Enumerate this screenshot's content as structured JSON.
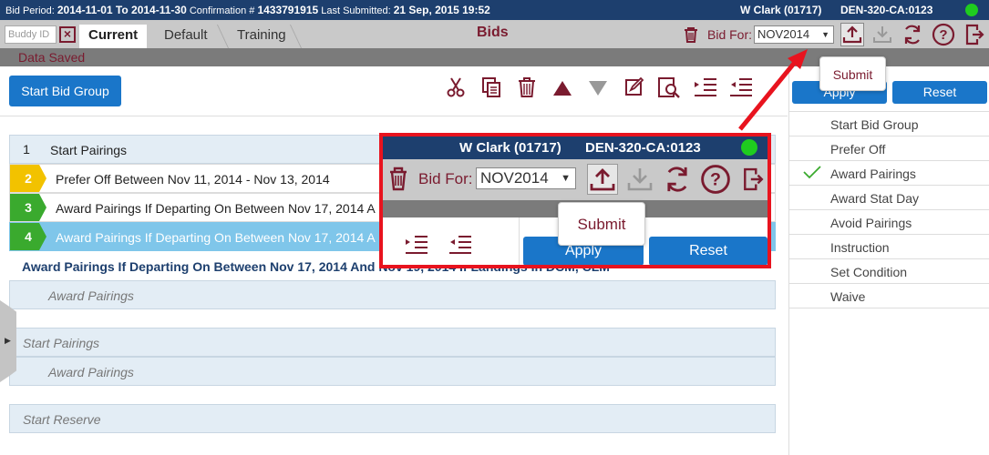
{
  "topbar": {
    "bid_period_label": "Bid Period:",
    "bid_period_value": "2014-11-01 To 2014-11-30",
    "confirmation_label": "Confirmation #",
    "confirmation_value": "1433791915",
    "last_submitted_label": "Last Submitted:",
    "last_submitted_value": "21 Sep, 2015 19:52",
    "user": "W Clark (01717)",
    "code": "DEN-320-CA:0123",
    "status_color": "#1fcc1f"
  },
  "tabbar": {
    "buddy_placeholder": "Buddy ID",
    "tabs": [
      "Current",
      "Default",
      "Training"
    ],
    "title": "Bids",
    "bid_for_label": "Bid For:",
    "bid_for_value": "NOV2014"
  },
  "saved_message": "Data Saved",
  "toolbar": {
    "start_bid_group": "Start Bid Group",
    "tooltip": "Submit"
  },
  "rows": [
    {
      "num": "1",
      "text": "Start Pairings"
    },
    {
      "num": "2",
      "text": "Prefer Off Between Nov 11, 2014 - Nov 13, 2014"
    },
    {
      "num": "3",
      "text": "Award Pairings If Departing On Between Nov 17, 2014 A"
    },
    {
      "num": "4",
      "text": "Award Pairings If Departing On Between Nov 17, 2014 A"
    }
  ],
  "detail_text": "Award Pairings If Departing On Between Nov 17, 2014 And Nov 19, 2014 If Landings In DCM, CLM",
  "award_pairings_1": "Award Pairings",
  "start_pairings_2": "Start Pairings",
  "award_pairings_2": "Award Pairings",
  "start_reserve": "Start Reserve",
  "right_panel": {
    "apply": "Apply",
    "reset": "Reset",
    "items": [
      "Start Bid Group",
      "Prefer Off",
      "Award Pairings",
      "Award Stat Day",
      "Avoid Pairings",
      "Instruction",
      "Set Condition",
      "Waive"
    ],
    "checked_index": 2
  },
  "zoom": {
    "user": "W Clark (01717)",
    "code": "DEN-320-CA:0123",
    "bid_for_label": "Bid For:",
    "bid_for_value": "NOV2014",
    "tooltip": "Submit",
    "apply": "Apply",
    "reset": "Reset"
  },
  "colors": {
    "accent_maroon": "#7a1b2f",
    "nav_blue": "#1d3f6e",
    "button_blue": "#1a76c9",
    "row2_yellow": "#f2c200",
    "row_green": "#3aaa2e",
    "selected_blue": "#7fc6ea",
    "callout_red": "#e8131e"
  }
}
